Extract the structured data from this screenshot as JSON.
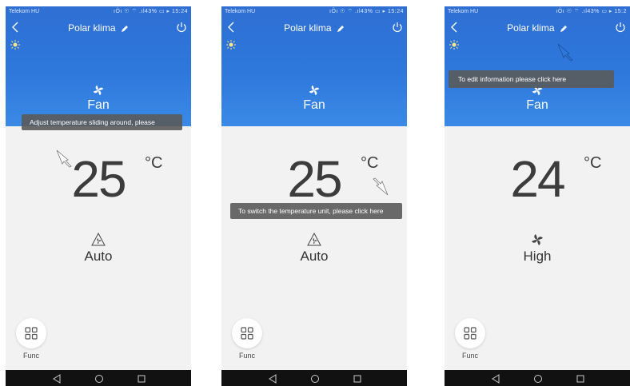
{
  "screens": [
    {
      "status": {
        "carrier": "Telekom HU",
        "right": "ıÖı ☉ ⌔ .ıl43% ▭ ▸ 15:24"
      },
      "title": "Polar klima",
      "mode": "Fan",
      "temperature": "25",
      "unit": "°C",
      "fan_speed": "Auto",
      "func_label": "Func",
      "tooltip": "Adjust temperature sliding around, please"
    },
    {
      "status": {
        "carrier": "Telekom HU",
        "right": "ıÖı ☉ ⌔ .ıl43% ▭ ▸ 15:24"
      },
      "title": "Polar klima",
      "mode": "Fan",
      "temperature": "25",
      "unit": "°C",
      "fan_speed": "Auto",
      "func_label": "Func",
      "tooltip": "To switch the temperature unit, please click here"
    },
    {
      "status": {
        "carrier": "Telekom HU",
        "right": "ıÖı ☉ ⌔ .ıl43% ▭ ▸ 15:2"
      },
      "title": "Polar klima",
      "mode": "Fan",
      "temperature": "24",
      "unit": "°C",
      "fan_speed": "High",
      "func_label": "Func",
      "tooltip": "To edit information please click here"
    }
  ],
  "icons": [
    "back-icon",
    "power-icon",
    "pencil-icon",
    "sun-icon",
    "fan-icon",
    "auto-fan-icon",
    "func-grid-icon",
    "pointer-arrow-icon",
    "nav-back-icon",
    "nav-home-icon",
    "nav-recent-icon"
  ],
  "colors": {
    "header_blue": "#2e78dc",
    "tooltip_bg": "#5a5a5a",
    "screen_bg": "#f2f2f2",
    "navbar": "#111111"
  }
}
